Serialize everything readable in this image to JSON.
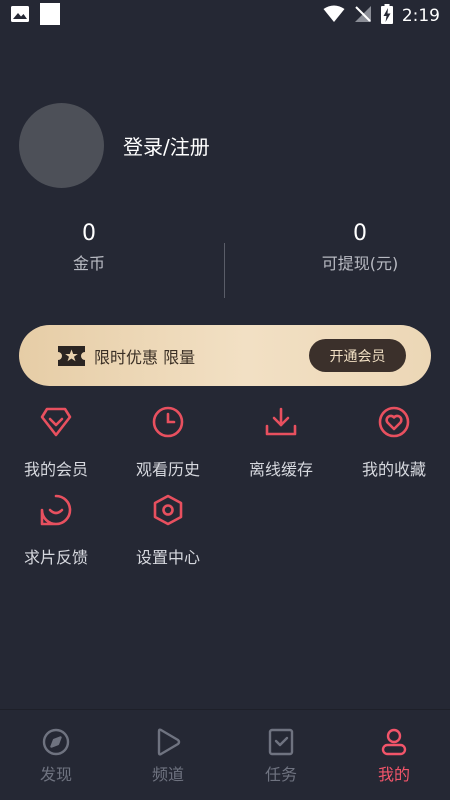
{
  "status_bar": {
    "time": "2:19",
    "left_icons": [
      "image-icon",
      "square-icon"
    ],
    "right_icons": [
      "wifi-icon",
      "no-signal-icon",
      "battery-charging-icon"
    ]
  },
  "profile": {
    "login_label": "登录/注册"
  },
  "stats": {
    "coins": {
      "value": "0",
      "label": "金币"
    },
    "cash": {
      "value": "0",
      "label": "可提现(元)"
    }
  },
  "vip_banner": {
    "text": "限时优惠 限量",
    "button_label": "开通会员",
    "icon": "ticket-star-icon"
  },
  "menu": [
    {
      "label": "我的会员",
      "icon": "diamond-icon"
    },
    {
      "label": "观看历史",
      "icon": "clock-icon"
    },
    {
      "label": "离线缓存",
      "icon": "download-icon"
    },
    {
      "label": "我的收藏",
      "icon": "heart-icon"
    },
    {
      "label": "求片反馈",
      "icon": "chat-smile-icon"
    },
    {
      "label": "设置中心",
      "icon": "settings-hexagon-icon"
    }
  ],
  "bottom_nav": [
    {
      "label": "发现",
      "icon": "compass-icon",
      "active": false
    },
    {
      "label": "频道",
      "icon": "play-icon",
      "active": false
    },
    {
      "label": "任务",
      "icon": "task-icon",
      "active": false
    },
    {
      "label": "我的",
      "icon": "user-icon",
      "active": true
    }
  ],
  "colors": {
    "background": "#252834",
    "accent": "#f2556a",
    "icon_red": "#e8505f",
    "vip_gold": "#e6cda6"
  }
}
